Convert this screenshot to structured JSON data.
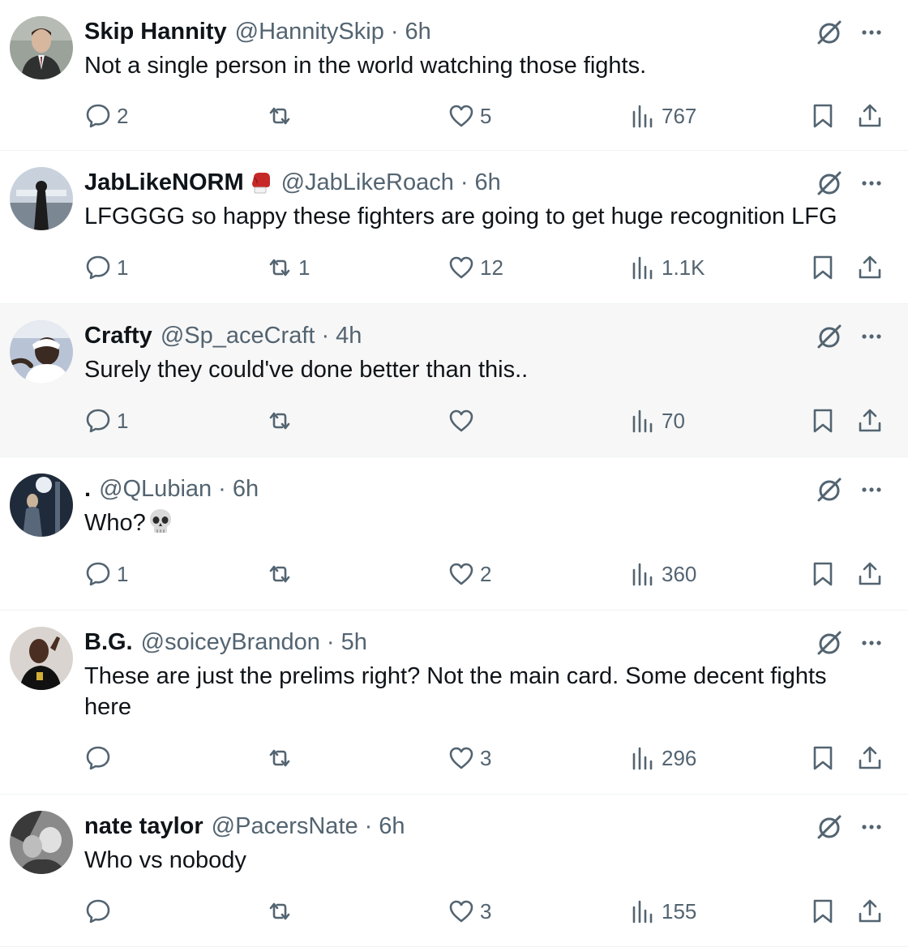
{
  "replies": [
    {
      "name": "Skip Hannity",
      "handle": "@HannitySkip",
      "sep": "·",
      "time": "6h",
      "text": "Not a single person in the world watching those fights.",
      "replies": "2",
      "reposts": "",
      "likes": "5",
      "views": "767",
      "avatar_colors": [
        "#9aa29a",
        "#2f3130",
        "#d8b79f"
      ]
    },
    {
      "name": "JabLikeNORM",
      "handle": "@JabLikeRoach",
      "sep": "·",
      "time": "6h",
      "text": "LFGGGG so happy these fighters are going to get huge recognition LFG",
      "replies": "1",
      "reposts": "1",
      "likes": "12",
      "views": "1.1K",
      "badge": "boxing-glove-emoji",
      "avatar_colors": [
        "#c9d2dc",
        "#1c1c1c",
        "#7c8794"
      ]
    },
    {
      "name": "Crafty",
      "handle": "@Sp_aceCraft",
      "sep": "·",
      "time": "4h",
      "text": "Surely they could've done better than this..",
      "replies": "1",
      "reposts": "",
      "likes": "",
      "views": "70",
      "avatar_colors": [
        "#b8c4d6",
        "#ffffff",
        "#3a2a22"
      ]
    },
    {
      "name": ".",
      "handle": "@QLubian",
      "sep": "·",
      "time": "6h",
      "text": "Who?",
      "emoji": "skull-emoji",
      "replies": "1",
      "reposts": "",
      "likes": "2",
      "views": "360",
      "avatar_colors": [
        "#1f2a3a",
        "#e9eef5",
        "#58677a"
      ]
    },
    {
      "name": "B.G.",
      "handle": "@soiceyBrandon",
      "sep": "·",
      "time": "5h",
      "text": "These are just the prelims right? Not the main card. Some decent fights here",
      "replies": "",
      "reposts": "",
      "likes": "3",
      "views": "296",
      "avatar_colors": [
        "#d9d4cf",
        "#4a2e22",
        "#111111"
      ]
    },
    {
      "name": "nate taylor",
      "handle": "@PacersNate",
      "sep": "·",
      "time": "6h",
      "text": "Who vs nobody",
      "replies": "",
      "reposts": "",
      "likes": "3",
      "views": "155",
      "avatar_colors": [
        "#8a8a8a",
        "#e0e0e0",
        "#3a3a3a"
      ]
    }
  ],
  "colors": {
    "text": "#0f1419",
    "secondary": "#536471",
    "divider": "#eff3f4",
    "highlight_bg": "#f7f7f7"
  },
  "icons": {
    "reply": "speech-bubble-icon",
    "repost": "repost-arrows-icon",
    "like": "heart-icon",
    "views": "bar-chart-icon",
    "bookmark": "bookmark-icon",
    "share": "share-upload-icon",
    "grok": "grok-slash-icon",
    "more": "ellipsis-icon"
  }
}
